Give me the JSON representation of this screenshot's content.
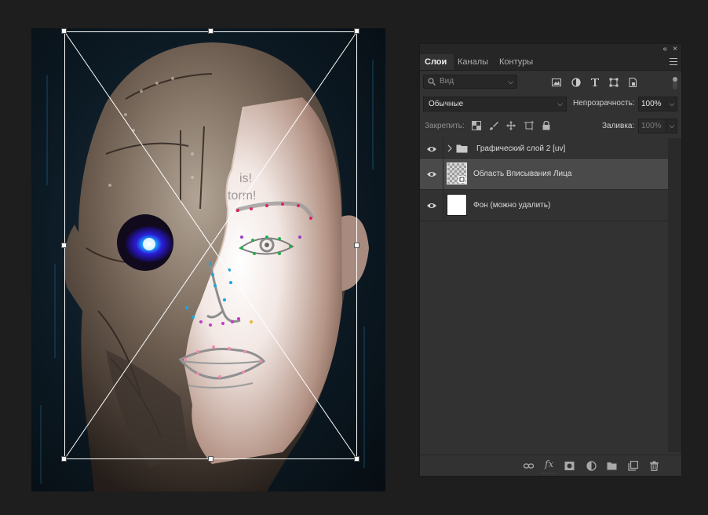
{
  "panel": {
    "tabs": [
      {
        "label": "Слои",
        "active": true
      },
      {
        "label": "Каналы",
        "active": false
      },
      {
        "label": "Контуры",
        "active": false
      }
    ],
    "collapse_glyph": "«",
    "close_glyph": "×",
    "filter": {
      "placeholder": "Вид",
      "kind_icons": [
        "image-filter-icon",
        "adjustment-filter-icon",
        "type-filter-icon",
        "shape-filter-icon",
        "smart-object-filter-icon"
      ]
    },
    "blend_mode": "Обычные",
    "opacity_label": "Непрозрачность:",
    "opacity_value": "100%",
    "lock_label": "Закрепить:",
    "fill_label": "Заливка:",
    "fill_value": "100%",
    "layers": [
      {
        "name": "Графический слой 2 [uv]",
        "type": "group",
        "selected": false
      },
      {
        "name": "Область Вписывания Лица",
        "type": "smart-object",
        "selected": true
      },
      {
        "name": "Фон (можно удалить)",
        "type": "pixel",
        "selected": false
      }
    ],
    "bottom_icons": [
      "link-layers-icon",
      "fx-icon",
      "add-mask-icon",
      "adjustment-layer-icon",
      "new-group-icon",
      "new-layer-icon",
      "delete-layer-icon"
    ],
    "fx_glyph": "fx"
  },
  "canvas": {
    "watermark_lines": [
      "is!",
      "torm!"
    ],
    "colors": {
      "bounding_box": "#ffffff",
      "selected_layer": "#4a4a4a",
      "eye_glow": "#3b28ff"
    }
  }
}
